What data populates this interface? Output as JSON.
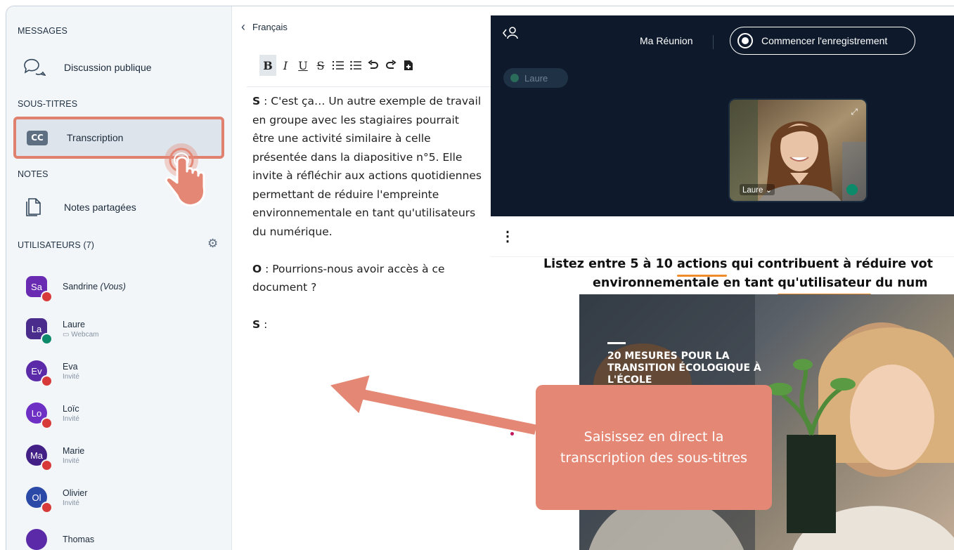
{
  "sidebar": {
    "messages_title": "MESSAGES",
    "public_chat_label": "Discussion publique",
    "subtitles_title": "SOUS-TITRES",
    "transcription_label": "Transcription",
    "cc_icon_text": "CC",
    "notes_title": "NOTES",
    "shared_notes_label": "Notes partagées",
    "users_title": "UTILISATEURS (7)",
    "users": [
      {
        "initials": "Sa",
        "name": "Sandrine",
        "suffix": "(Vous)",
        "role": "",
        "color": "#6a2bb3",
        "shape": "square",
        "status": "mute"
      },
      {
        "initials": "La",
        "name": "Laure",
        "suffix": "",
        "role": "▭ Webcam",
        "color": "#4a2c8c",
        "shape": "square",
        "status": "mic"
      },
      {
        "initials": "Ev",
        "name": "Eva",
        "suffix": "",
        "role": "Invité",
        "color": "#5a2aa8",
        "shape": "round",
        "status": "mute"
      },
      {
        "initials": "Lo",
        "name": "Loïc",
        "suffix": "",
        "role": "Invité",
        "color": "#6d2fc4",
        "shape": "round",
        "status": "mute"
      },
      {
        "initials": "Ma",
        "name": "Marie",
        "suffix": "",
        "role": "Invité",
        "color": "#432086",
        "shape": "round",
        "status": "mute"
      },
      {
        "initials": "Ol",
        "name": "Olivier",
        "suffix": "",
        "role": "Invité",
        "color": "#2b4aa8",
        "shape": "round",
        "status": "mute"
      },
      {
        "initials": "",
        "name": "Thomas",
        "suffix": "",
        "role": "",
        "color": "#5a2aa8",
        "shape": "round",
        "status": ""
      }
    ]
  },
  "editor": {
    "language": "Français",
    "toolbar": [
      "B",
      "I",
      "U",
      "S",
      "ol",
      "ul",
      "undo",
      "redo",
      "save"
    ],
    "transcript": [
      {
        "speaker": "S",
        "text": " : C'est ça… Un autre exemple de travail en groupe avec les stagiaires pourrait être une activité similaire à celle présentée dans la diapositive n°5. Elle invite à réfléchir aux actions quotidiennes permettant de réduire l'empreinte environnementale en tant qu'utilisateurs du numérique."
      },
      {
        "speaker": "O",
        "text": " : Pourrions-nous avoir accès à ce document ?"
      },
      {
        "speaker": "S",
        "text": " :"
      }
    ]
  },
  "meeting": {
    "title": "Ma Réunion",
    "record_label": "Commencer l'enregistrement",
    "talker": "Laure",
    "webcam_name": "Laure ⌄",
    "slide_line1_a": "Listez entre 5 à 10 ",
    "slide_line1_b": "actions",
    "slide_line1_c": " qui contribuent à réduire vot",
    "slide_line2_a": "environnementale en tant ",
    "slide_line2_b": "qu'utilisateur",
    "slide_line2_c": " du num",
    "photo_caption": "20 MESURES POUR LA TRANSITION ÉCOLOGIQUE À L'ÉCOLE"
  },
  "callout": {
    "text": "Saisissez en direct la transcription des sous-titres"
  },
  "colors": {
    "highlight": "#e0806f",
    "callout": "#e48774",
    "video_bg": "#0e1a2b",
    "underline": "#f08b2a"
  }
}
